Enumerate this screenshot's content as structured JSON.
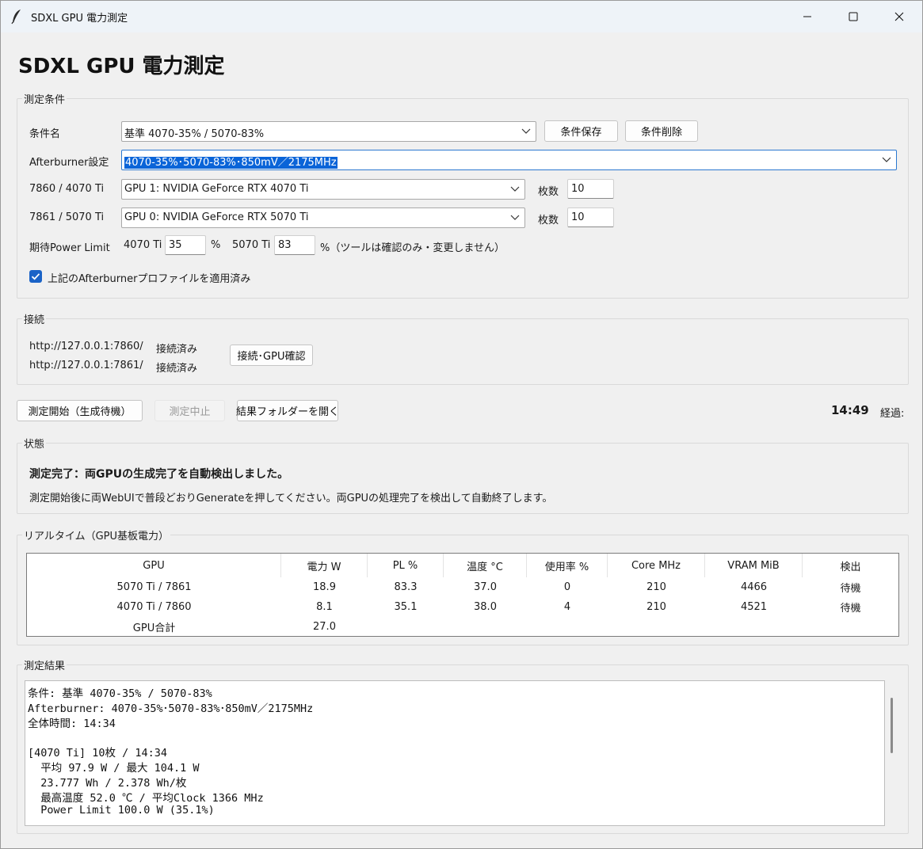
{
  "window": {
    "title": "SDXL GPU 電力測定"
  },
  "app_title": "SDXL GPU 電力測定",
  "conditions": {
    "group_label": "測定条件",
    "name_label": "条件名",
    "name_value": "基準 4070-35% / 5070-83%",
    "save_button": "条件保存",
    "delete_button": "条件削除",
    "afterburner_label": "Afterburner設定",
    "afterburner_value": "4070-35%･5070-83%･850mV／2175MHz",
    "gpu1_label": "7860 / 4070 Ti",
    "gpu1_value": "GPU 1: NVIDIA GeForce RTX 4070 Ti",
    "gpu1_count_label": "枚数",
    "gpu1_count": "10",
    "gpu2_label": "7861 / 5070 Ti",
    "gpu2_value": "GPU 0: NVIDIA GeForce RTX 5070 Ti",
    "gpu2_count_label": "枚数",
    "gpu2_count": "10",
    "pl_label": "期待Power Limit",
    "pl_4070_label": "4070 Ti",
    "pl_4070_value": "35",
    "pl_unit1": "%",
    "pl_5070_label": "5070 Ti",
    "pl_5070_value": "83",
    "pl_note": "%（ツールは確認のみ・変更しません）",
    "profile_check_label": "上記のAfterburnerプロファイルを適用済み",
    "profile_checked": true
  },
  "connection": {
    "group_label": "接続",
    "url1": "http://127.0.0.1:7860/",
    "status1": "接続済み",
    "url2": "http://127.0.0.1:7861/",
    "status2": "接続済み",
    "check_button": "接続･GPU確認"
  },
  "actions": {
    "start_button": "測定開始（生成待機）",
    "stop_button": "測定中止",
    "open_folder_button": "結果フォルダーを開く",
    "elapsed_time": "14:49",
    "elapsed_label": "経過:"
  },
  "status": {
    "group_label": "状態",
    "headline": "測定完了：両GPUの生成完了を自動検出しました。",
    "detail": "測定開始後に両WebUIで普段どおりGenerateを押してください。両GPUの処理完了を検出して自動終了します。"
  },
  "realtime": {
    "group_label": "リアルタイム（GPU基板電力）",
    "columns": [
      "GPU",
      "電力 W",
      "PL %",
      "温度 °C",
      "使用率 %",
      "Core MHz",
      "VRAM MiB",
      "検出"
    ],
    "rows": [
      [
        "5070 Ti / 7861",
        "18.9",
        "83.3",
        "37.0",
        "0",
        "210",
        "4466",
        "待機"
      ],
      [
        "4070 Ti / 7860",
        "8.1",
        "35.1",
        "38.0",
        "4",
        "210",
        "4521",
        "待機"
      ],
      [
        "GPU合計",
        "27.0",
        "",
        "",
        "",
        "",
        "",
        ""
      ]
    ]
  },
  "results": {
    "group_label": "測定結果",
    "lines": [
      "条件: 基準 4070-35% / 5070-83%",
      "Afterburner: 4070-35%･5070-83%･850mV／2175MHz",
      "全体時間: 14:34",
      "",
      "[4070 Ti] 10枚 / 14:34",
      "  平均 97.9 W / 最大 104.1 W",
      "  23.777 Wh / 2.378 Wh/枚",
      "  最高温度 52.0 ℃ / 平均Clock 1366 MHz",
      "  Power Limit 100.0 W (35.1%)"
    ]
  },
  "colors": {
    "accent": "#1a63c7",
    "selection": "#0a64d8"
  },
  "icons": {
    "app": "feather-icon",
    "minimize": "minimize-icon",
    "maximize": "maximize-icon",
    "close": "close-icon",
    "dropdown": "chevron-down-icon",
    "check": "checkmark-icon"
  }
}
